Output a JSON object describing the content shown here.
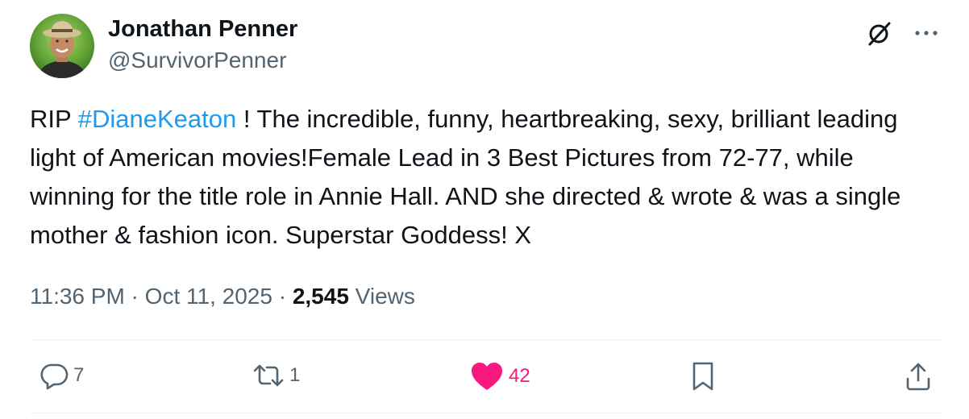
{
  "author": {
    "display_name": "Jonathan Penner",
    "handle": "@SurvivorPenner"
  },
  "tweet": {
    "text_prefix": "RIP ",
    "hashtag": "#DianeKeaton",
    "text_body": " ! The incredible, funny, heartbreaking, sexy, brilliant leading light of American movies!Female Lead in 3 Best Pictures from 72-77, while winning for the title role in Annie Hall. AND she directed & wrote & was a single mother & fashion icon. Superstar Goddess! X"
  },
  "meta": {
    "time": "11:36 PM",
    "separator": " · ",
    "date": "Oct 11, 2025",
    "views_count": "2,545",
    "views_label": " Views"
  },
  "actions": {
    "replies": "7",
    "reposts": "1",
    "likes": "42"
  },
  "icons": {
    "avatar": "profile-photo",
    "grok": "grok-icon",
    "more": "more-icon",
    "reply": "reply-icon",
    "repost": "repost-icon",
    "like": "heart-icon",
    "bookmark": "bookmark-icon",
    "share": "share-icon"
  },
  "colors": {
    "link": "#1d9bf0",
    "secondary_text": "#536471",
    "like_active": "#f91880",
    "divider": "#eff3f4"
  }
}
